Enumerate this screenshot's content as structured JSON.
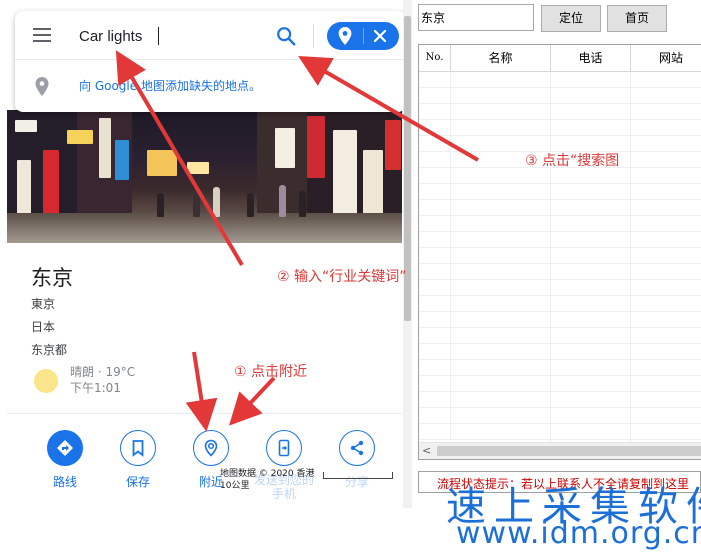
{
  "search": {
    "query": "Car lights",
    "add_missing_place": "向 Google 地图添加缺失的地点。"
  },
  "place": {
    "title": "东京",
    "lines": [
      "東京",
      "日本",
      "东京都"
    ],
    "weather": "晴朗 · 19°C",
    "time": "下午1:01"
  },
  "actions": [
    {
      "label": "路线",
      "icon": "directions-icon"
    },
    {
      "label": "保存",
      "icon": "bookmark-icon"
    },
    {
      "label": "附近",
      "icon": "nearby-icon"
    },
    {
      "label": "发送到您的手机",
      "icon": "send-to-phone-icon"
    },
    {
      "label": "分享",
      "icon": "share-icon"
    }
  ],
  "map_attribution": {
    "text": "地图数据 © 2020 香港",
    "scale": "10公里"
  },
  "tool": {
    "city_value": "东京",
    "locate_button": "定位",
    "home_button": "首页",
    "columns": [
      "No.",
      "名称",
      "电话",
      "网站"
    ],
    "status": "流程状态提示：若以上联系人不全请复制到这里"
  },
  "annotations": {
    "step1": "① 点击附近",
    "step2": "② 输入“行业关键词”",
    "step3": "③ 点击“搜索图"
  },
  "watermark": {
    "name": "速上采集软件",
    "url": "www.idm.org.cn"
  },
  "colors": {
    "google_blue": "#1a73e8",
    "annotation_red": "#e23838",
    "watermark_blue": "#1b6fd6"
  }
}
